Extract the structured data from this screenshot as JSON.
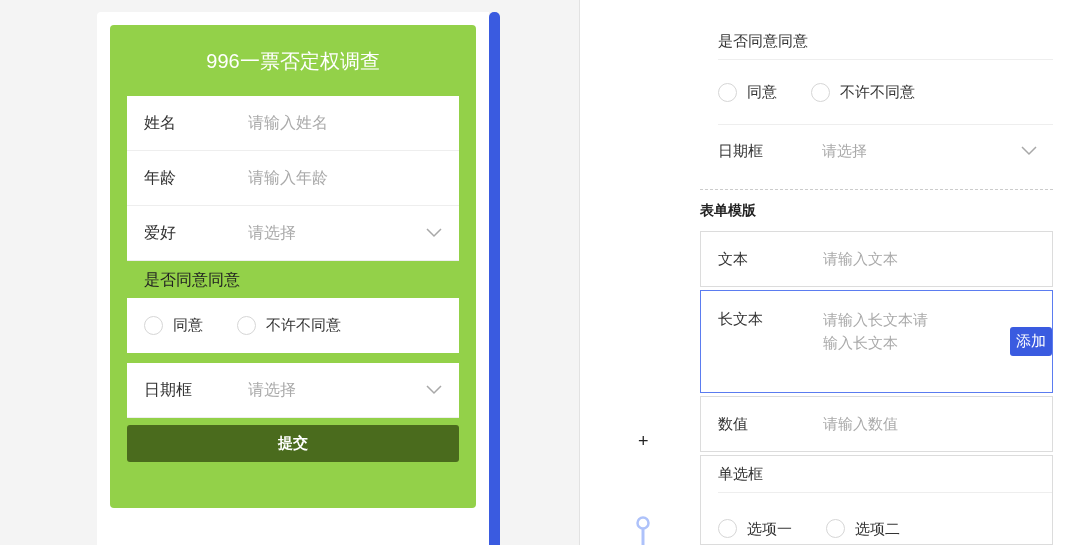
{
  "form": {
    "title": "996一票否定权调查",
    "fields": [
      {
        "kind": "input",
        "label": "姓名",
        "placeholder": "请输入姓名"
      },
      {
        "kind": "input",
        "label": "年龄",
        "placeholder": "请输入年龄"
      },
      {
        "kind": "select",
        "label": "爱好",
        "placeholder": "请选择"
      },
      {
        "kind": "radio",
        "label": "是否同意同意",
        "options": [
          {
            "label": "同意",
            "selected": false
          },
          {
            "label": "不许不同意",
            "selected": false
          }
        ]
      },
      {
        "kind": "select",
        "label": "日期框",
        "placeholder": "请选择"
      }
    ],
    "submit": "提交"
  },
  "canvas": {
    "add_symbol": "+"
  },
  "settings": {
    "fields": [
      {
        "kind": "radio",
        "label": "是否同意同意",
        "options": [
          {
            "label": "同意",
            "selected": false
          },
          {
            "label": "不许不同意",
            "selected": false
          }
        ]
      },
      {
        "kind": "select",
        "label": "日期框",
        "placeholder": "请选择"
      }
    ],
    "templates_title": "表单模版",
    "templates": [
      {
        "kind": "input",
        "label": "文本",
        "placeholder": "请输入文本",
        "selected": false
      },
      {
        "kind": "textarea",
        "label": "长文本",
        "placeholder": "请输入长文本请输入长文本",
        "selected": true
      },
      {
        "kind": "input",
        "label": "数值",
        "placeholder": "请输入数值",
        "selected": false
      },
      {
        "kind": "radio",
        "label": "单选框",
        "selected": false,
        "options": [
          {
            "label": "选项一",
            "selected": false
          },
          {
            "label": "选项二",
            "selected": false
          }
        ]
      }
    ],
    "add_button": "添加"
  }
}
